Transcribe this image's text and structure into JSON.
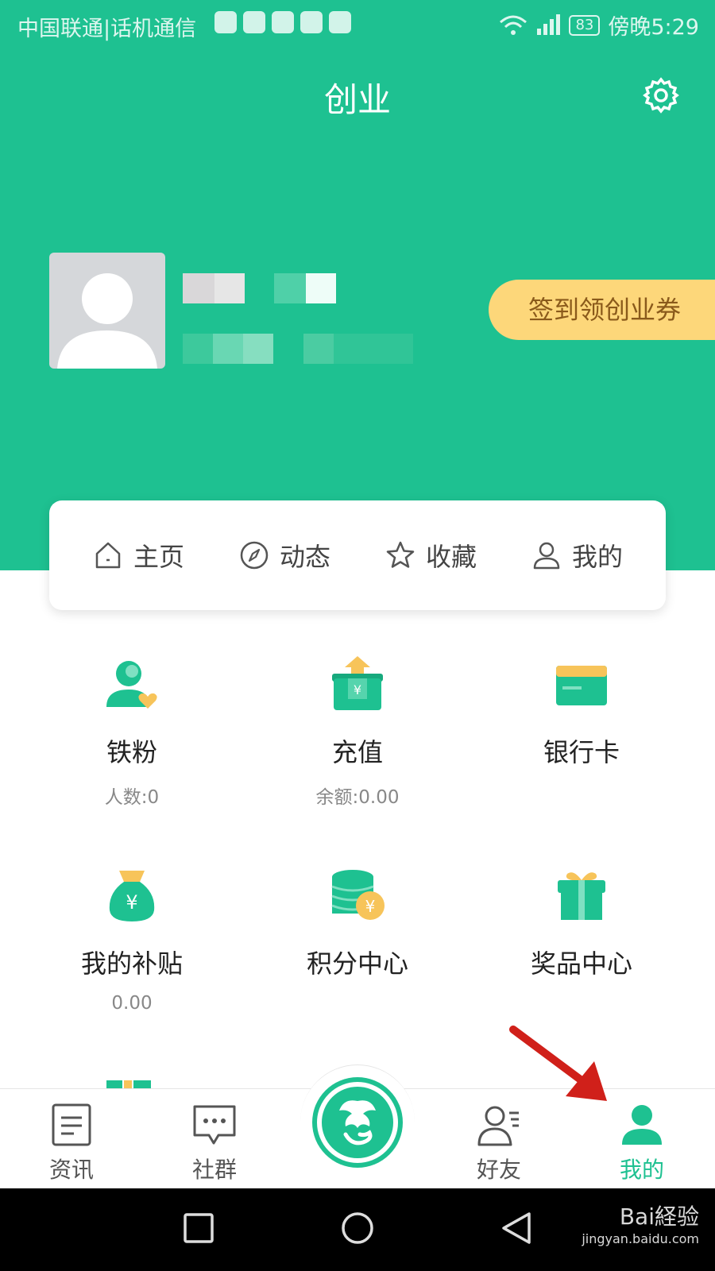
{
  "status_bar": {
    "carrier": "中国联通|话机通信",
    "battery": "83",
    "time": "傍晚5:29"
  },
  "header": {
    "title": "创业",
    "settings_icon": "gear-icon"
  },
  "profile": {
    "signin_label": "签到领创业券"
  },
  "tabs": [
    {
      "label": "主页",
      "icon": "home-icon"
    },
    {
      "label": "动态",
      "icon": "compass-icon"
    },
    {
      "label": "收藏",
      "icon": "star-icon"
    },
    {
      "label": "我的",
      "icon": "person-icon"
    }
  ],
  "grid": [
    {
      "label": "铁粉",
      "sub": "人数:0",
      "icon": "fans-icon"
    },
    {
      "label": "充值",
      "sub": "余额:0.00",
      "icon": "recharge-icon"
    },
    {
      "label": "银行卡",
      "sub": "",
      "icon": "bank-card-icon"
    },
    {
      "label": "我的补贴",
      "sub": "0.00",
      "icon": "money-bag-icon"
    },
    {
      "label": "积分中心",
      "sub": "",
      "icon": "coins-icon"
    },
    {
      "label": "奖品中心",
      "sub": "",
      "icon": "gift-icon"
    }
  ],
  "bottom_nav": [
    {
      "label": "资讯",
      "icon": "news-icon"
    },
    {
      "label": "社群",
      "icon": "chat-icon"
    },
    {
      "label": "好友",
      "icon": "friends-icon"
    },
    {
      "label": "我的",
      "icon": "me-icon",
      "active": true
    }
  ],
  "watermark": {
    "brand": "Bai経验",
    "url": "jingyan.baidu.com"
  },
  "colors": {
    "primary": "#1ec191",
    "signin_bg": "#fdd77a",
    "annotation_arrow": "#d0201a"
  }
}
